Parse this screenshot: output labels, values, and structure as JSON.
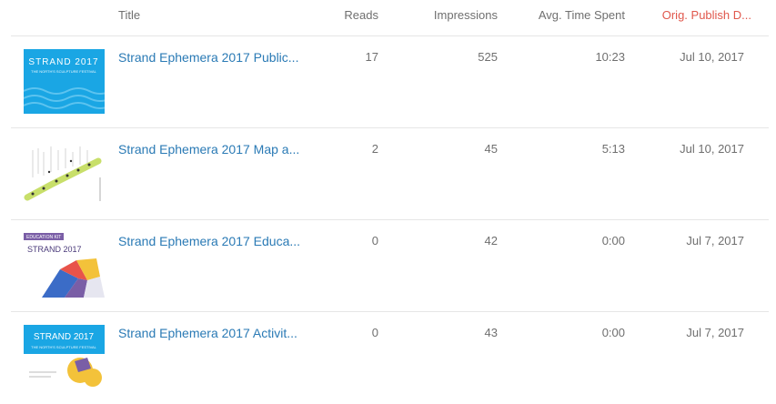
{
  "header": {
    "title": "Title",
    "reads": "Reads",
    "impressions": "Impressions",
    "avg_time": "Avg. Time Spent",
    "publish_date": "Orig. Publish D..."
  },
  "accent_colors": {
    "link": "#2a7ab5",
    "sorted_header": "#e0574c",
    "thumb_blue": "#1aa6e4",
    "thumb_purple": "#7a5ea6"
  },
  "thumbnail_text": {
    "brand": "STRAND 2017",
    "tagline": "THE NORTH'S SCULPTURE FESTIVAL",
    "edu_badge": "EDUCATION KIT"
  },
  "rows": [
    {
      "title": "Strand Ephemera 2017 Public...",
      "reads": "17",
      "impressions": "525",
      "avg_time": "10:23",
      "date": "Jul 10, 2017"
    },
    {
      "title": "Strand Ephemera 2017 Map a...",
      "reads": "2",
      "impressions": "45",
      "avg_time": "5:13",
      "date": "Jul 10, 2017"
    },
    {
      "title": "Strand Ephemera 2017 Educa...",
      "reads": "0",
      "impressions": "42",
      "avg_time": "0:00",
      "date": "Jul 7, 2017"
    },
    {
      "title": "Strand Ephemera 2017 Activit...",
      "reads": "0",
      "impressions": "43",
      "avg_time": "0:00",
      "date": "Jul 7, 2017"
    }
  ]
}
